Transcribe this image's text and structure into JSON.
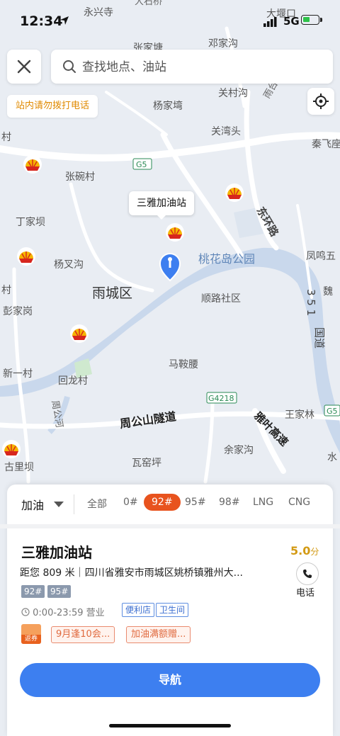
{
  "status_bar": {
    "time": "12:34",
    "network": "5G"
  },
  "search": {
    "placeholder": "查找地点、油站",
    "close_icon": "close-icon",
    "search_icon": "search-icon"
  },
  "notice": "站内请勿拨打电话",
  "map": {
    "place_labels": [
      "永兴寺",
      "大石桥",
      "大堰口",
      "张家塘",
      "邓家沟",
      "关村沟",
      "雨台",
      "杨家塆",
      "关湾头",
      "秦飞座",
      "村",
      "张碗村",
      "东环路",
      "丁家坝",
      "凤鸣五",
      "杨叉沟",
      "桃花岛公园",
      "雨城区",
      "顺路社区",
      "魏",
      "彭家岗",
      "村",
      "马鞍腰",
      "国道",
      "新一村",
      "回龙村",
      "周公河",
      "G4218",
      "王家林",
      "周公山隧道",
      "雅叶高速",
      "余家沟",
      "瓦窑坪",
      "古里坝",
      "G5",
      "水"
    ],
    "road_badges": [
      "G5",
      "G4218",
      "G5"
    ],
    "highway_321": "3 5 1",
    "selected_station_callout": "三雅加油站",
    "station_marker_icon": "gas-station-marker-icon",
    "user_pin_icon": "location-pin-icon",
    "colors": {
      "river": "#c9d8ec",
      "land": "#e9edf3",
      "road": "#ffffff",
      "park": "#cfe9cf"
    }
  },
  "filters": {
    "fuel_type": "加油",
    "chips": [
      "全部",
      "0#",
      "92#",
      "95#",
      "98#",
      "LNG",
      "CNG"
    ],
    "active_chip": "92#",
    "accent_color": "#e8531e"
  },
  "station": {
    "name": "三雅加油站",
    "score": "5.0",
    "score_unit": "分",
    "distance_address": "距您 809 米｜四川省雅安市雨城区姚桥镇雅州大...",
    "call_label": "电话",
    "grades": [
      "92#",
      "95#"
    ],
    "hours": "0:00-23:59 营业",
    "services": [
      "便利店",
      "卫生间"
    ],
    "coupon_label": "返券",
    "promos": [
      "9月逢10会...",
      "加油满额赠..."
    ]
  },
  "navigate_label": "导航"
}
